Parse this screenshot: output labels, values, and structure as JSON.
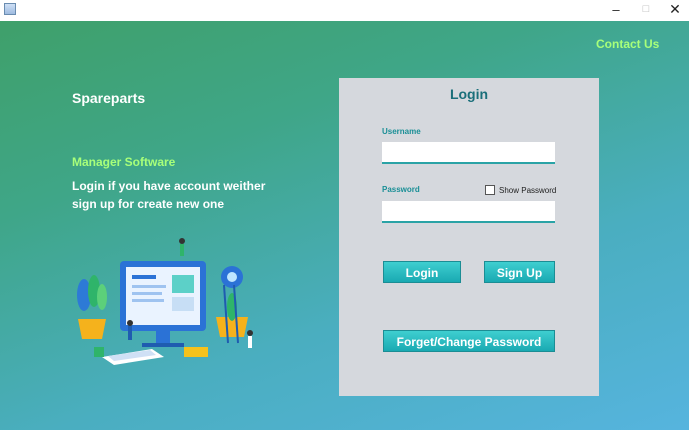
{
  "window": {
    "min_glyph": "–",
    "max_glyph": "□",
    "close_glyph": "✕"
  },
  "header": {
    "contact": "Contact Us"
  },
  "left": {
    "brand": "Spareparts",
    "subtitle": "Manager Software",
    "desc_line1": "Login if you have account weither",
    "desc_line2": "sign up for create new one"
  },
  "login": {
    "title": "Login",
    "username_label": "Username",
    "username_value": "",
    "password_label": "Password",
    "password_value": "",
    "show_password": "Show Password",
    "show_password_checked": false,
    "login_button": "Login",
    "signup_button": "Sign Up",
    "forget_button": "Forget/Change Password"
  },
  "colors": {
    "accent": "#1a8f96",
    "highlight": "#a8ff7a",
    "panel": "#d5d8dd"
  }
}
